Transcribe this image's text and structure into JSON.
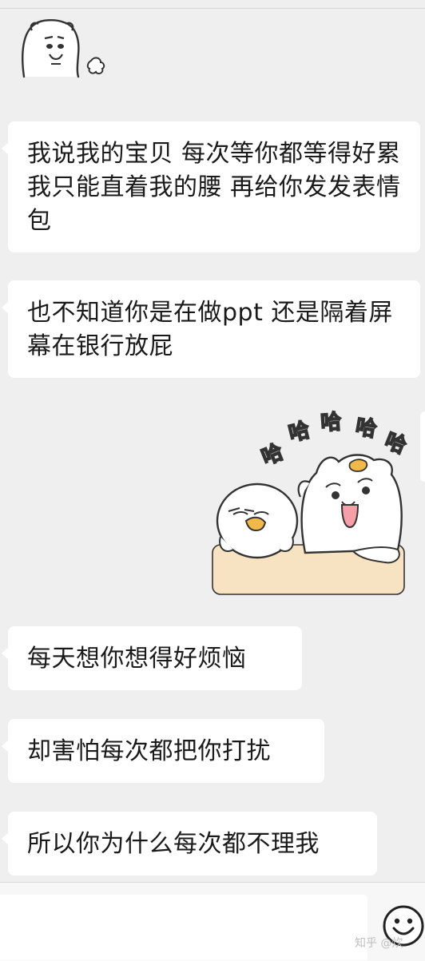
{
  "chat": {
    "messages": [
      {
        "sender": "other",
        "type": "sticker",
        "sticker": "bear-face-sticker"
      },
      {
        "sender": "other",
        "type": "text",
        "text": "我说我的宝贝 每次等你都等得好累 我只能直着我的腰 再给你发发表情包"
      },
      {
        "sender": "other",
        "type": "text",
        "text": "也不知道你是在做ppt 还是隔着屏幕在银行放屁"
      },
      {
        "sender": "me",
        "type": "sticker",
        "sticker": "haha-sticker",
        "sticker_text": "哈哈哈哈哈"
      },
      {
        "sender": "other",
        "type": "text",
        "text": "每天想你想得好烦恼"
      },
      {
        "sender": "other",
        "type": "text",
        "text": "却害怕每次都把你打扰"
      },
      {
        "sender": "other",
        "type": "text",
        "text": "所以你为什么每次都不理我"
      }
    ]
  },
  "input_bar": {
    "value": "",
    "emoji_icon": "smiley-icon"
  },
  "watermark": "知乎 @炊"
}
